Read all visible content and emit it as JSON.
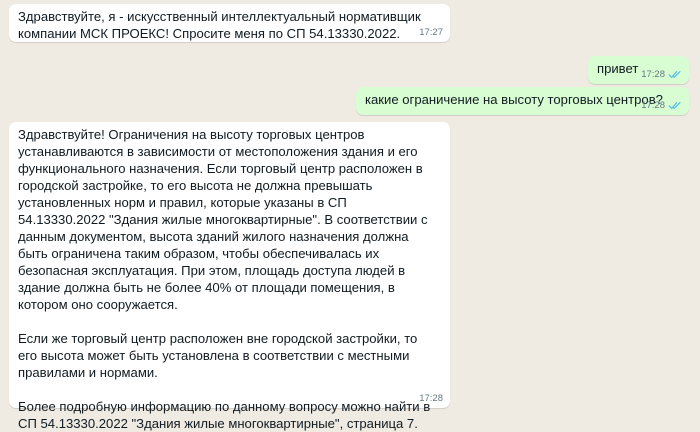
{
  "conversation": {
    "messages": [
      {
        "direction": "incoming",
        "text": "Здравствуйте, я - искусственный интеллектуальный нормативщик компании МСК ПРОЕКС! Спросите меня по СП 54.13330.2022.",
        "time": "17:27"
      },
      {
        "direction": "outgoing",
        "text": "привет",
        "time": "17:28",
        "read_status": "double-check-icon"
      },
      {
        "direction": "outgoing",
        "text": "какие ограничение на высоту торговых центров?",
        "time": "17:28",
        "read_status": "double-check-icon"
      },
      {
        "direction": "incoming",
        "text": "Здравствуйте! Ограничения на высоту торговых центров устанавливаются в зависимости от местоположения здания и его функционального назначения. Если торговый центр расположен в городской застройке, то его высота не должна превышать установленных норм и правил, которые указаны в СП 54.13330.2022 \"Здания жилые многоквартирные\". В соответствии с данным документом, высота зданий жилого назначения должна быть ограничена таким образом, чтобы обеспечивалась их безопасная эксплуатация. При этом, площадь доступа людей в здание должна быть не более 40% от площади помещения, в котором оно сооружается.\n\nЕсли же торговый центр расположен вне городской застройки, то его высота может быть установлена в соответствии с местными правилами и нормами.\n\nБолее подробную информацию по данному вопросу можно найти в СП 54.13330.2022 \"Здания жилые многоквартирные\", страница 7.",
        "time": "17:28"
      }
    ]
  },
  "colors": {
    "background": "#efeae2",
    "incoming_bubble": "#ffffff",
    "outgoing_bubble": "#d9fdd3",
    "read_ticks": "#53bdeb",
    "timestamp": "#667781"
  }
}
